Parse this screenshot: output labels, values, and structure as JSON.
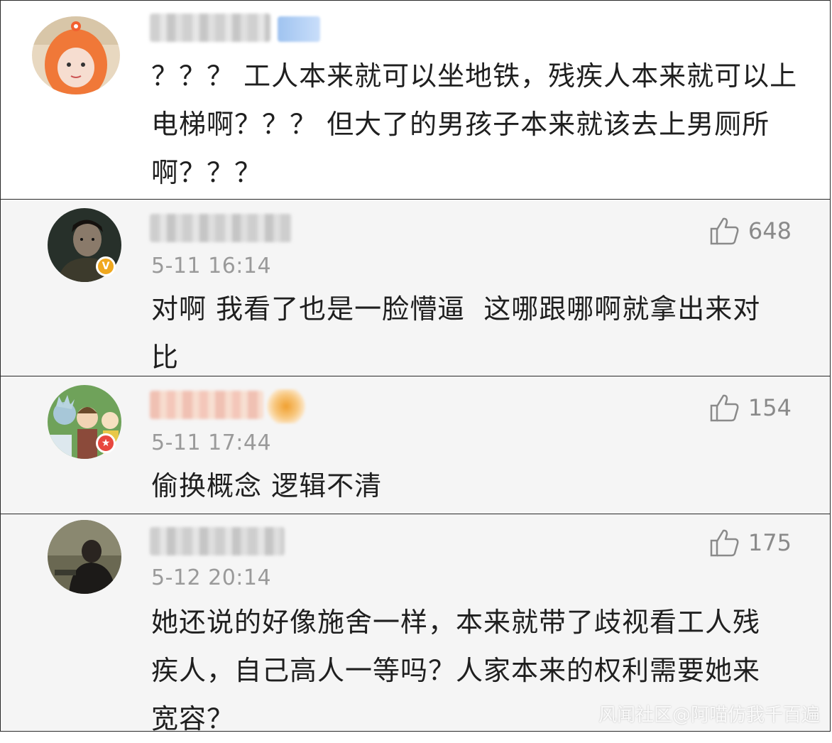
{
  "main_comment": {
    "text": "？？？ 工人本来就可以坐地铁，残疾人本来就可以上电梯啊？？？ 但大了的男孩子本来就该去上男厕所啊？？？"
  },
  "replies": [
    {
      "time": "5-11 16:14",
      "likes": "648",
      "text": "对啊 我看了也是一脸懵逼  这哪跟哪啊就拿出来对比",
      "badge_color": "#f0a81e",
      "badge_icon": "verified-v-icon"
    },
    {
      "time": "5-11 17:44",
      "likes": "154",
      "text": "偷换概念 逻辑不清",
      "badge_color": "#e8473e",
      "badge_icon": "star-badge-icon"
    },
    {
      "time": "5-12 20:14",
      "likes": "175",
      "text": "她还说的好像施舍一样，本来就带了歧视看工人残疾人，自己高人一等吗？人家本来的权利需要她来宽容？"
    }
  ],
  "watermark": "风闻社区@阿喵仿我千百遍"
}
